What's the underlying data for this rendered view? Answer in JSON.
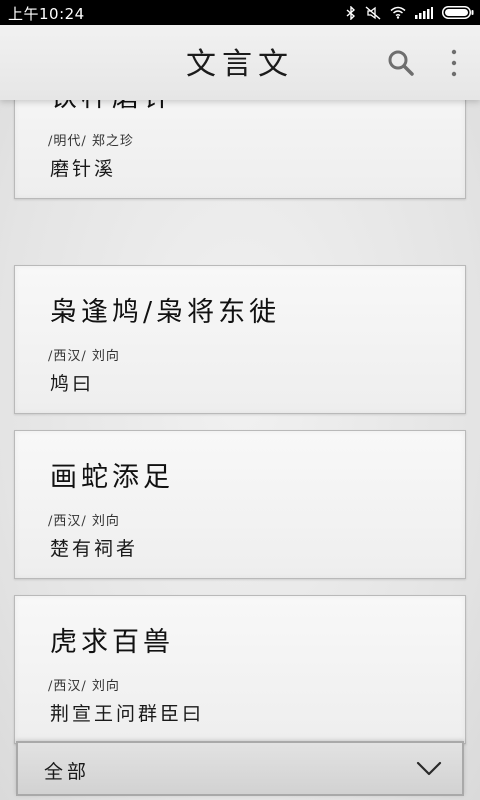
{
  "status_bar": {
    "time": "上午10:24",
    "icons": [
      "bluetooth-icon",
      "silent-icon",
      "wifi-icon",
      "signal-icon",
      "battery-icon"
    ]
  },
  "header": {
    "title": "文言文",
    "actions": [
      "search-icon",
      "overflow-menu-icon"
    ]
  },
  "cards": [
    {
      "title": "铁杵磨针",
      "meta": "/明代/ 郑之珍",
      "first_line": "磨针溪"
    },
    {
      "title": "枭逢鸠/枭将东徙",
      "meta": "/西汉/ 刘向",
      "first_line": "鸠曰"
    },
    {
      "title": "画蛇添足",
      "meta": "/西汉/ 刘向",
      "first_line": "楚有祠者"
    },
    {
      "title": "虎求百兽",
      "meta": "/西汉/ 刘向",
      "first_line": "荆宣王问群臣曰"
    }
  ],
  "filter": {
    "label": "全部",
    "icon": "chevron-down-icon"
  }
}
